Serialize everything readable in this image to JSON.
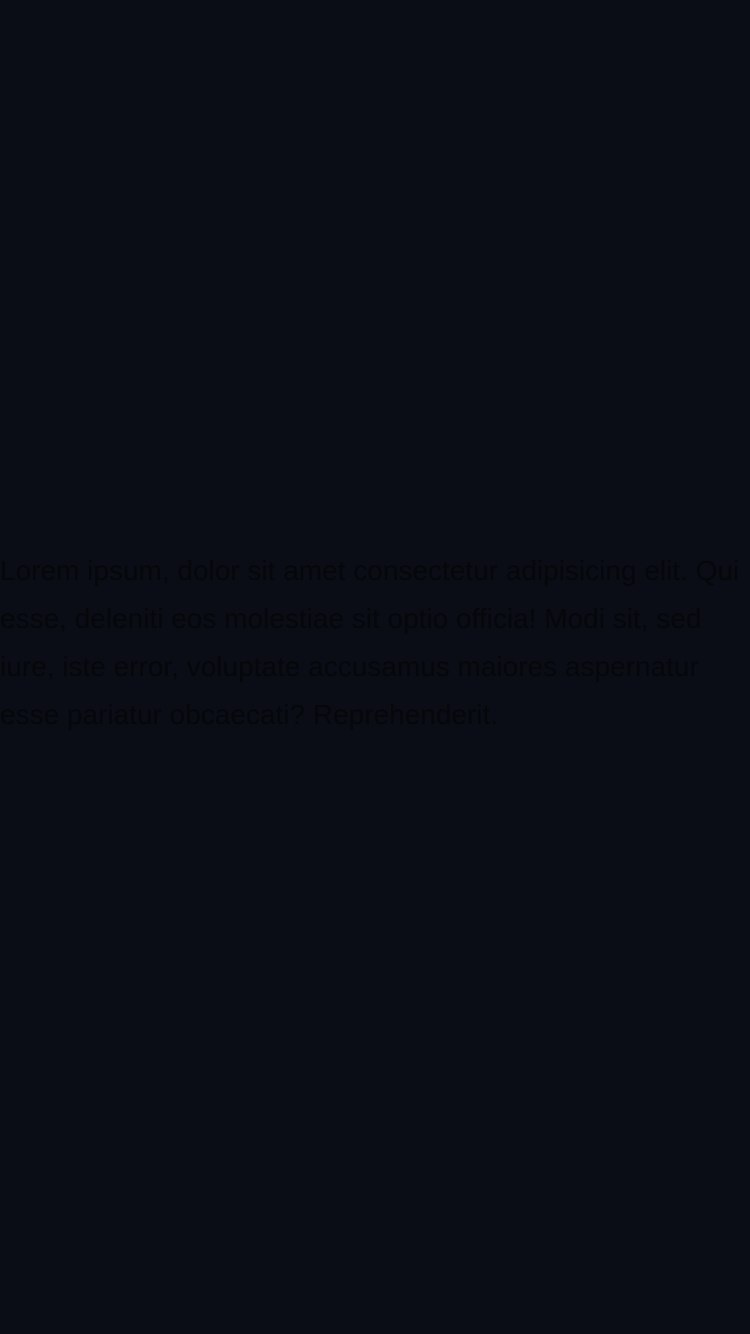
{
  "content": {
    "paragraph": "Lorem ipsum, dolor sit amet consectetur adipisicing elit. Qui esse, deleniti eos molestiae sit optio officia! Modi sit, sed iure, iste error, voluptate accusamus maiores aspernatur esse pariatur obcaecati? Reprehenderit."
  },
  "colors": {
    "background": "#0a0d15",
    "text": "#06070b"
  }
}
